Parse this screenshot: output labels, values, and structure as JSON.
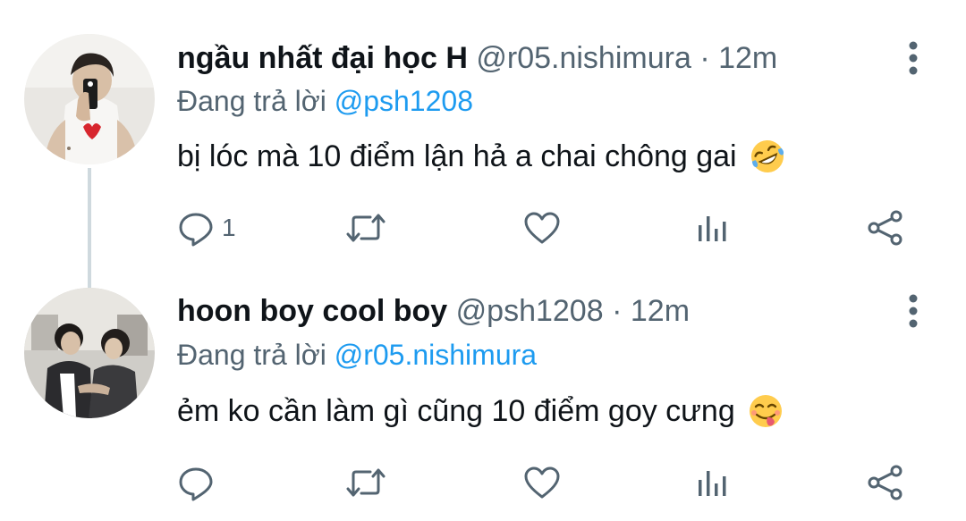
{
  "tweets": [
    {
      "display_name": "ngầu nhất đại học H",
      "handle": "@r05.nishimura",
      "separator": "·",
      "time": "12m",
      "reply_prefix": "Đang trả lời",
      "reply_to": "@psh1208",
      "text": "bị lóc mà 10 điểm lận hả a chai chông gai",
      "emoji": "rolling-on-floor-laughing-emoji",
      "reply_count": "1"
    },
    {
      "display_name": "hoon boy cool boy",
      "handle": "@psh1208",
      "separator": "·",
      "time": "12m",
      "reply_prefix": "Đang trả lời",
      "reply_to": "@r05.nishimura",
      "text": "ẻm ko cần làm gì cũng 10 điểm goy cưng",
      "emoji": "face-savoring-food-emoji",
      "reply_count": ""
    }
  ],
  "colors": {
    "text": "#0f1419",
    "secondary": "#536471",
    "link": "#1d9bf0",
    "thread_line": "#cfd9de"
  }
}
